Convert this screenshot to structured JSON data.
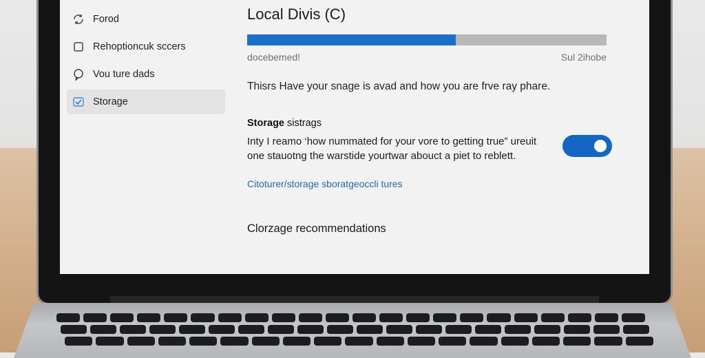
{
  "sidebar": {
    "items": [
      {
        "label": "Forod",
        "icon": "sync-icon"
      },
      {
        "label": "Rehoptioncuk sccers",
        "icon": "square-icon"
      },
      {
        "label": "Vou ture dads",
        "icon": "chat-icon"
      },
      {
        "label": "Storage",
        "icon": "storage-icon",
        "active": true
      }
    ]
  },
  "main": {
    "title": "Local Divis (C)",
    "usage": {
      "used_fraction": 0.58,
      "left_label": "docebemed!",
      "right_label": "Sul 2ihobe"
    },
    "description": "Thisrs Have your snage is avad and how you are frve ray phare.",
    "storage_sense": {
      "title_bold": "Storage",
      "title_rest": "sistrags",
      "text": "Inty I reamo ‘how nummated for your vore to getting true” ureuit one stauotng the warstide yourtwar abouct a piet to reblett.",
      "toggle_on": true
    },
    "link": "Citoturer/storage sboratgeoccli tures",
    "recommendations_title": "Clorzage recommendations"
  },
  "colors": {
    "accent": "#1a6fc9",
    "toggle": "#1466c4",
    "link": "#2467b8"
  }
}
